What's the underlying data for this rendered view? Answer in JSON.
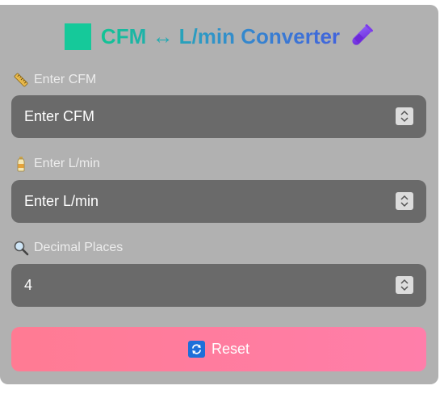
{
  "header": {
    "title": "CFM ↔ L/min Converter",
    "square_color": "#15c99a",
    "leading_icon": "green-square",
    "trailing_icon": "test-tube-icon"
  },
  "fields": [
    {
      "label": "Enter CFM",
      "icon": "ruler-icon",
      "placeholder": "Enter CFM",
      "value": ""
    },
    {
      "label": "Enter L/min",
      "icon": "bottle-icon",
      "placeholder": "Enter L/min",
      "value": ""
    },
    {
      "label": "Decimal Places",
      "icon": "magnifier-icon",
      "placeholder": "",
      "value": "4"
    }
  ],
  "reset": {
    "label": "Reset",
    "icon": "refresh-icon"
  },
  "colors": {
    "card_bg": "#b1b1b1",
    "field_bg": "#6a6a6a",
    "reset_gradient_start": "#ff7b93",
    "reset_gradient_end": "#ff7eaa",
    "title_gradient": [
      "#12c494",
      "#2f96c7",
      "#4163dd"
    ]
  }
}
